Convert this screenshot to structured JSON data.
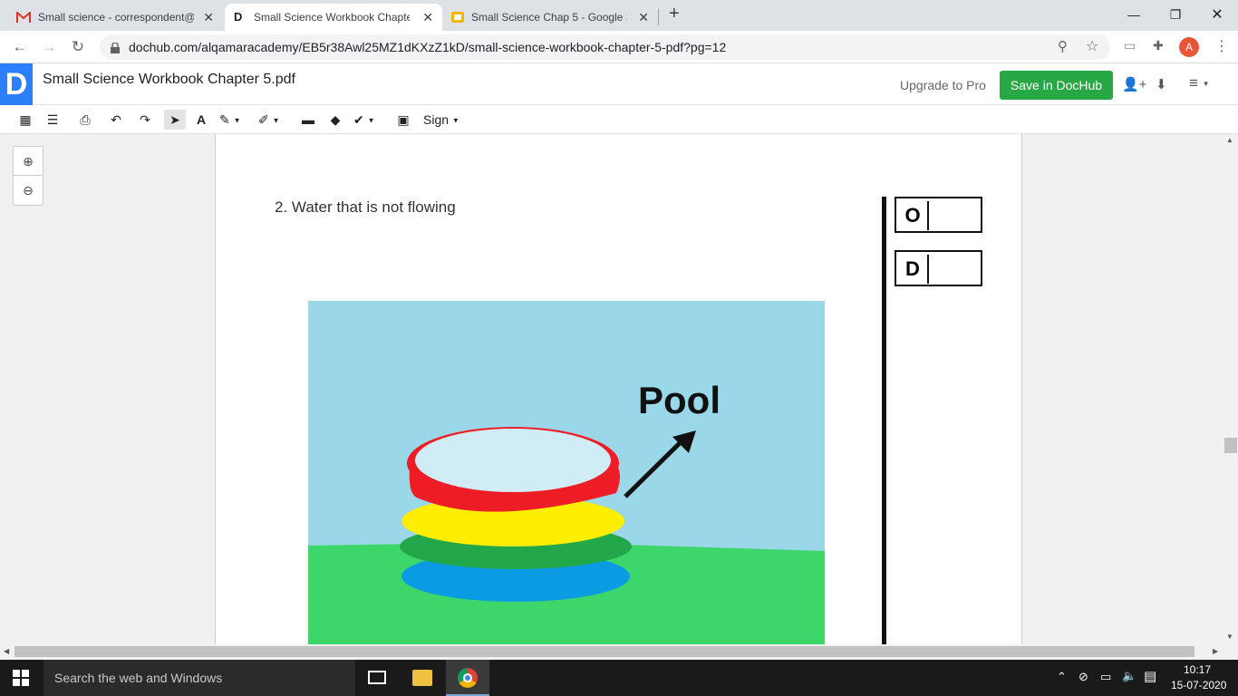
{
  "browser": {
    "tabs": [
      {
        "title": "Small science - correspondent@a",
        "active": false,
        "icon": "gmail-icon"
      },
      {
        "title": "Small Science Workbook Chapter",
        "active": true,
        "icon": "dochub-icon"
      },
      {
        "title": "Small Science Chap 5 - Google Sl",
        "active": false,
        "icon": "slides-icon"
      }
    ],
    "new_tab": "+",
    "url": "dochub.com/alqamaracademy/EB5r38Awl25MZ1dKXzZ1kD/small-science-workbook-chapter-5-pdf?pg=12",
    "profile_initial": "A"
  },
  "dochub": {
    "logo": "D",
    "doc_title": "Small Science Workbook Chapter 5.pdf",
    "upgrade_label": "Upgrade to Pro",
    "save_label": "Save in DocHub",
    "sign_label": "Sign"
  },
  "document": {
    "question": "2. Water that is not flowing",
    "image_label": "Pool",
    "answer_box_letters": [
      "O",
      "D"
    ]
  },
  "taskbar": {
    "search_placeholder": "Search the web and Windows",
    "time": "10:17",
    "date": "15-07-2020"
  },
  "colors": {
    "accent_blue": "#2d7ff9",
    "save_green": "#28a745",
    "sky": "#9ad7e9",
    "grass": "#3dd66b"
  }
}
